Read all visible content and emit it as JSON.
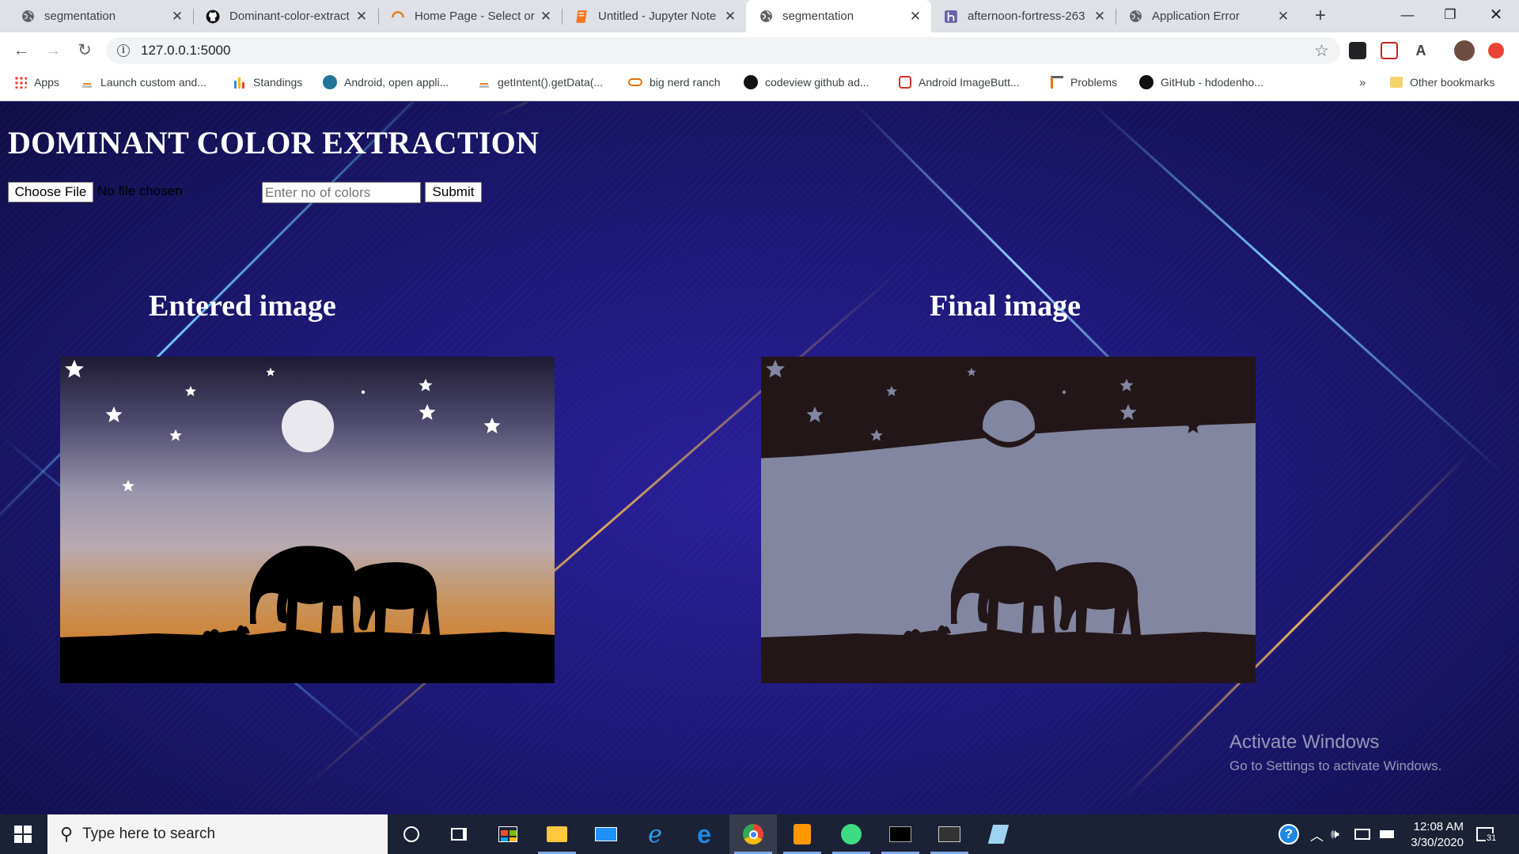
{
  "browser": {
    "tabs": [
      {
        "title": "segmentation",
        "icon": "globe-icon",
        "active": false
      },
      {
        "title": "Dominant-color-extract",
        "icon": "github-icon",
        "active": false
      },
      {
        "title": "Home Page - Select or",
        "icon": "loading-spinner-icon",
        "active": false
      },
      {
        "title": "Untitled - Jupyter Note",
        "icon": "jupyter-icon",
        "active": false
      },
      {
        "title": "segmentation",
        "icon": "globe-icon",
        "active": true
      },
      {
        "title": "afternoon-fortress-263",
        "icon": "heroku-icon",
        "active": false
      },
      {
        "title": "Application Error",
        "icon": "globe-icon",
        "active": false
      }
    ],
    "url": "127.0.0.1:5000",
    "bookmarks": [
      {
        "label": "Apps",
        "icon": "apps-grid-icon"
      },
      {
        "label": "Launch custom and...",
        "icon": "stack-icon"
      },
      {
        "label": "Standings",
        "icon": "bar-chart-icon"
      },
      {
        "label": "Android, open appli...",
        "icon": "wordpress-icon"
      },
      {
        "label": "getIntent().getData(...",
        "icon": "stack-icon"
      },
      {
        "label": "big nerd ranch",
        "icon": "link-icon"
      },
      {
        "label": "codeview github ad...",
        "icon": "github-icon"
      },
      {
        "label": "Android ImageButt...",
        "icon": "puzzle-icon"
      },
      {
        "label": "Problems",
        "icon": "problems-icon"
      },
      {
        "label": "GitHub - hdodenho...",
        "icon": "github-icon"
      }
    ],
    "overflow_label": "»",
    "other_bookmarks": "Other bookmarks"
  },
  "page": {
    "title": "DOMINANT COLOR EXTRACTION",
    "choose_file_label": "Choose File",
    "file_status": "No file chosen",
    "colors_placeholder": "Enter no of colors",
    "submit_label": "Submit",
    "entered_heading": "Entered image",
    "final_heading": "Final image"
  },
  "watermark": {
    "line1": "Activate Windows",
    "line2": "Go to Settings to activate Windows."
  },
  "taskbar": {
    "search_placeholder": "Type here to search",
    "time": "12:08 AM",
    "date": "3/30/2020",
    "notification_count": "31"
  },
  "colors": {
    "page_background": "#1d1878",
    "final_dark": "#231618",
    "final_light": "#8286a0"
  }
}
